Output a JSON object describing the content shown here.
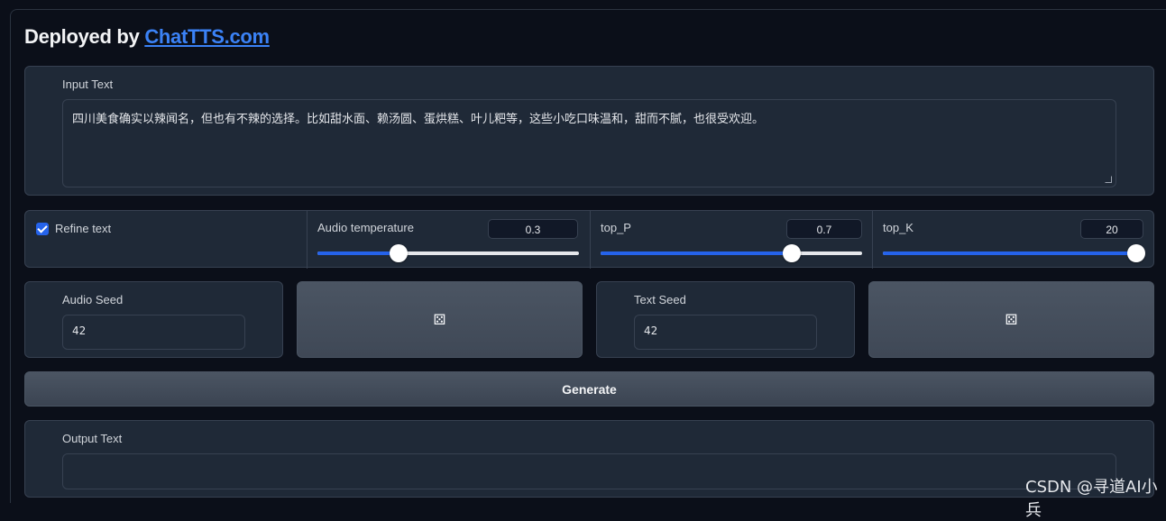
{
  "header": {
    "title_prefix": "Deployed by ",
    "title_link": "ChatTTS.com"
  },
  "input": {
    "label": "Input Text",
    "value": "四川美食确实以辣闻名，但也有不辣的选择。比如甜水面、赖汤圆、蛋烘糕、叶儿粑等，这些小吃口味温和，甜而不腻，也很受欢迎。"
  },
  "controls": {
    "refine_text": {
      "label": "Refine text",
      "checked": true
    },
    "audio_temperature": {
      "label": "Audio temperature",
      "value": "0.3",
      "fraction": 0.31
    },
    "top_p": {
      "label": "top_P",
      "value": "0.7",
      "fraction": 0.73
    },
    "top_k": {
      "label": "top_K",
      "value": "20",
      "fraction": 1.0
    }
  },
  "seeds": {
    "audio_seed": {
      "label": "Audio Seed",
      "value": "42"
    },
    "text_seed": {
      "label": "Text Seed",
      "value": "42"
    },
    "dice_icon": "dice-icon",
    "dice_glyph": "⚄"
  },
  "generate": {
    "label": "Generate"
  },
  "output": {
    "label": "Output Text",
    "value": ""
  },
  "watermark": "CSDN @寻道AI小兵",
  "colors": {
    "accent": "#2563eb",
    "link": "#3b82f6",
    "background": "#0b0f19",
    "panel": "#1f2937"
  }
}
